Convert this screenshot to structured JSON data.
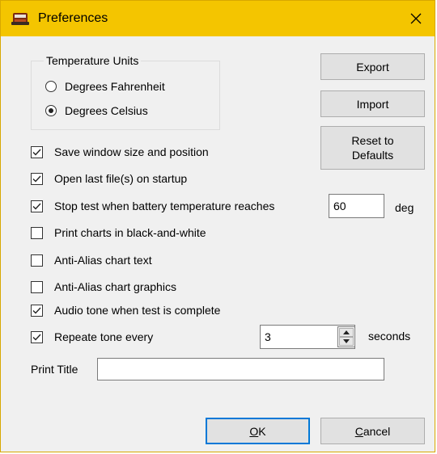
{
  "window": {
    "title": "Preferences"
  },
  "temperature_units": {
    "legend": "Temperature Units",
    "options": [
      {
        "label": "Degrees Fahrenheit",
        "selected": false
      },
      {
        "label": "Degrees Celsius",
        "selected": true
      }
    ]
  },
  "buttons": {
    "export": "Export",
    "import": "Import",
    "reset_line1": "Reset to",
    "reset_line2": "Defaults",
    "ok": "OK",
    "cancel": "Cancel"
  },
  "options": [
    {
      "label": "Save window size and position",
      "checked": true
    },
    {
      "label": "Open last file(s) on startup",
      "checked": true
    },
    {
      "label": "Stop test when battery temperature reaches",
      "checked": true
    },
    {
      "label": "Print charts in black-and-white",
      "checked": false
    },
    {
      "label": "Anti-Alias chart text",
      "checked": false
    },
    {
      "label": "Anti-Alias chart graphics",
      "checked": false
    },
    {
      "label": "Audio tone when test is complete",
      "checked": true
    },
    {
      "label": "Repeate tone every",
      "checked": true
    }
  ],
  "stop_temperature": {
    "value": "60",
    "unit": "deg"
  },
  "repeat_interval": {
    "value": "3",
    "unit": "seconds"
  },
  "print_title": {
    "label": "Print Title",
    "value": ""
  },
  "colors": {
    "titlebar": "#f4c500",
    "dialog": "#f0f0f0",
    "default_button_border": "#0078d7"
  }
}
